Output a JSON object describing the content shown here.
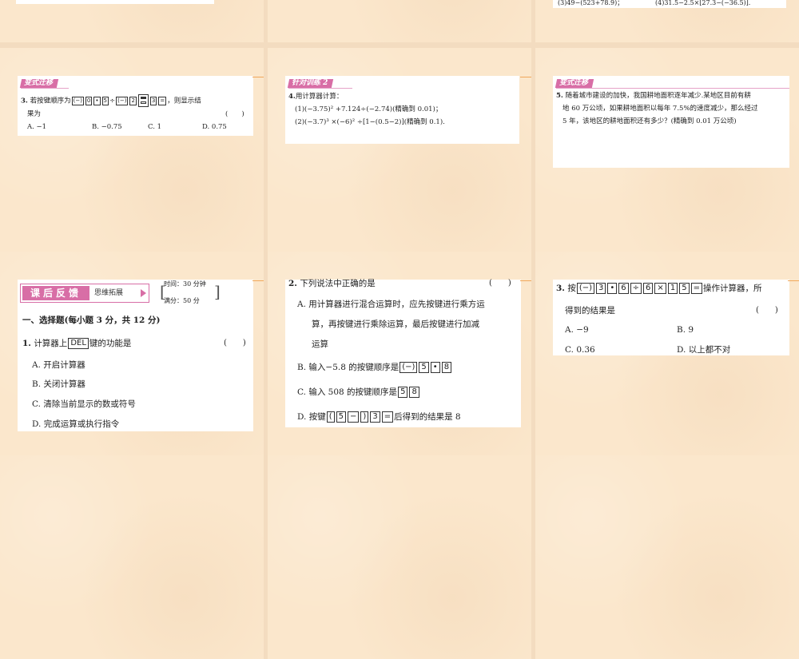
{
  "top_partial": {
    "right_fragment_a": "(3)49−(523+78.9)；",
    "right_fragment_b": "(4)31.5−2.5×[27.3−(−36.5)]."
  },
  "slide_a": {
    "tag": "变式迁移",
    "q_no": "3.",
    "q_prefix": "若按键顺序为",
    "keys": [
      "(−)",
      "0",
      "•",
      "5",
      "÷",
      "(−)",
      "2",
      "3",
      "="
    ],
    "q_suffix": "，则显示结",
    "q_line2": "果为",
    "paren": "(　　)",
    "options": [
      "A. −1",
      "B. −0.75",
      "C. 1",
      "D. 0.75"
    ]
  },
  "slide_b": {
    "tag": "针对训练 2",
    "q_no": "4.",
    "q_title": "用计算器计算：",
    "line1": "(1)(−3.75)² +7.124÷(−2.74)(精确到 0.01)；",
    "line2": "(2)(−3.7)³ ×(−6)² ÷[1−(0.5−2)](精确到 0.1)."
  },
  "slide_c": {
    "tag": "变式迁移",
    "q_no": "5.",
    "line1": "随着城市建设的加快，我国耕地面积逐年减少.某地区目前有耕",
    "line2": "地 60 万公顷，如果耕地面积以每年 7.5%的速度减少，那么经过",
    "line3": "5 年，该地区的耕地面积还有多少？(精确到 0.01 万公顷)"
  },
  "slide_d": {
    "banner_title": "课后反馈",
    "banner_sub": "思维拓展",
    "time": "时间：30 分钟",
    "score": "满分：50 分",
    "section": "一、选择题(每小题 3 分，共 12 分)",
    "q_no": "1.",
    "q_prefix": "计算器上",
    "q_key": "DEL",
    "q_suffix": "键的功能是",
    "paren": "(　　)",
    "options": [
      "A. 开启计算器",
      "B. 关闭计算器",
      "C. 清除当前显示的数或符号",
      "D. 完成运算或执行指令"
    ]
  },
  "slide_e": {
    "q_no": "2.",
    "q_text": "下列说法中正确的是",
    "paren": "(　　)",
    "optA_1": "A. 用计算器进行混合运算时，应先按键进行乘方运",
    "optA_2": "算，再按键进行乘除运算，最后按键进行加减",
    "optA_3": "运算",
    "optB": "B. 输入−5.8 的按键顺序是",
    "optB_keys": [
      "(−)",
      "5",
      "•",
      "8"
    ],
    "optC": "C. 输入 508 的按键顺序是",
    "optC_keys": [
      "5",
      "8"
    ],
    "optD_prefix": "D. 按键",
    "optD_keys": [
      "(",
      "5",
      "−",
      ")",
      "3",
      "="
    ],
    "optD_suffix": "后得到的结果是 8"
  },
  "slide_f": {
    "q_no": "3.",
    "q_prefix": "按",
    "keys": [
      "(−)",
      "3",
      "•",
      "6",
      "÷",
      "6",
      "×",
      "1",
      "5",
      "="
    ],
    "q_suffix": "操作计算器，所",
    "line2": "得到的结果是",
    "paren": "(　　)",
    "options": [
      "A. −9",
      "B. 9",
      "C. 0.36",
      "D. 以上都不对"
    ]
  },
  "colors": {
    "tag": "#d86ea6",
    "slide_bg": "#fbe7cc",
    "accent_line": "#f0a85c"
  }
}
